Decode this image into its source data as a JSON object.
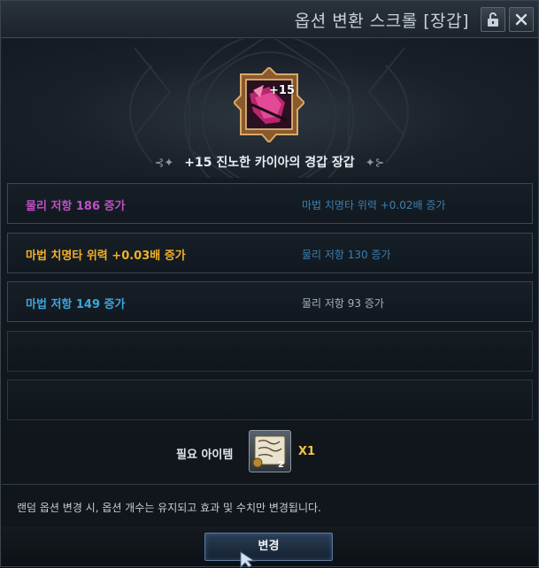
{
  "window": {
    "title": "옵션 변환 스크롤 [장갑]"
  },
  "item": {
    "enhance": "+15",
    "name": "+15 진노한 카이아의 경갑 장갑",
    "icon": "gauntlet-icon"
  },
  "options": [
    {
      "current": "물리 저항 186 증가",
      "current_color": "#c04fc4",
      "preview": "마법 치명타 위력 +0.02배 증가",
      "preview_color": "#3d7fae"
    },
    {
      "current": "마법 치명타 위력 +0.03배 증가",
      "current_color": "#f0b02a",
      "preview": "물리 저항 130 증가",
      "preview_color": "#3d7fae"
    },
    {
      "current": "마법 저항 149 증가",
      "current_color": "#3ea6dd",
      "preview": "물리 저항 93 증가",
      "preview_color": "#a7b0b8"
    },
    {
      "current": "",
      "preview": ""
    },
    {
      "current": "",
      "preview": ""
    }
  ],
  "required": {
    "label": "필요 아이템",
    "count": "X1",
    "icon": "scroll-icon"
  },
  "notice": "랜덤 옵션 변경 시, 옵션 개수는 유지되고 효과 및 수치만 변경됩니다.",
  "buttons": {
    "change": "변경"
  }
}
